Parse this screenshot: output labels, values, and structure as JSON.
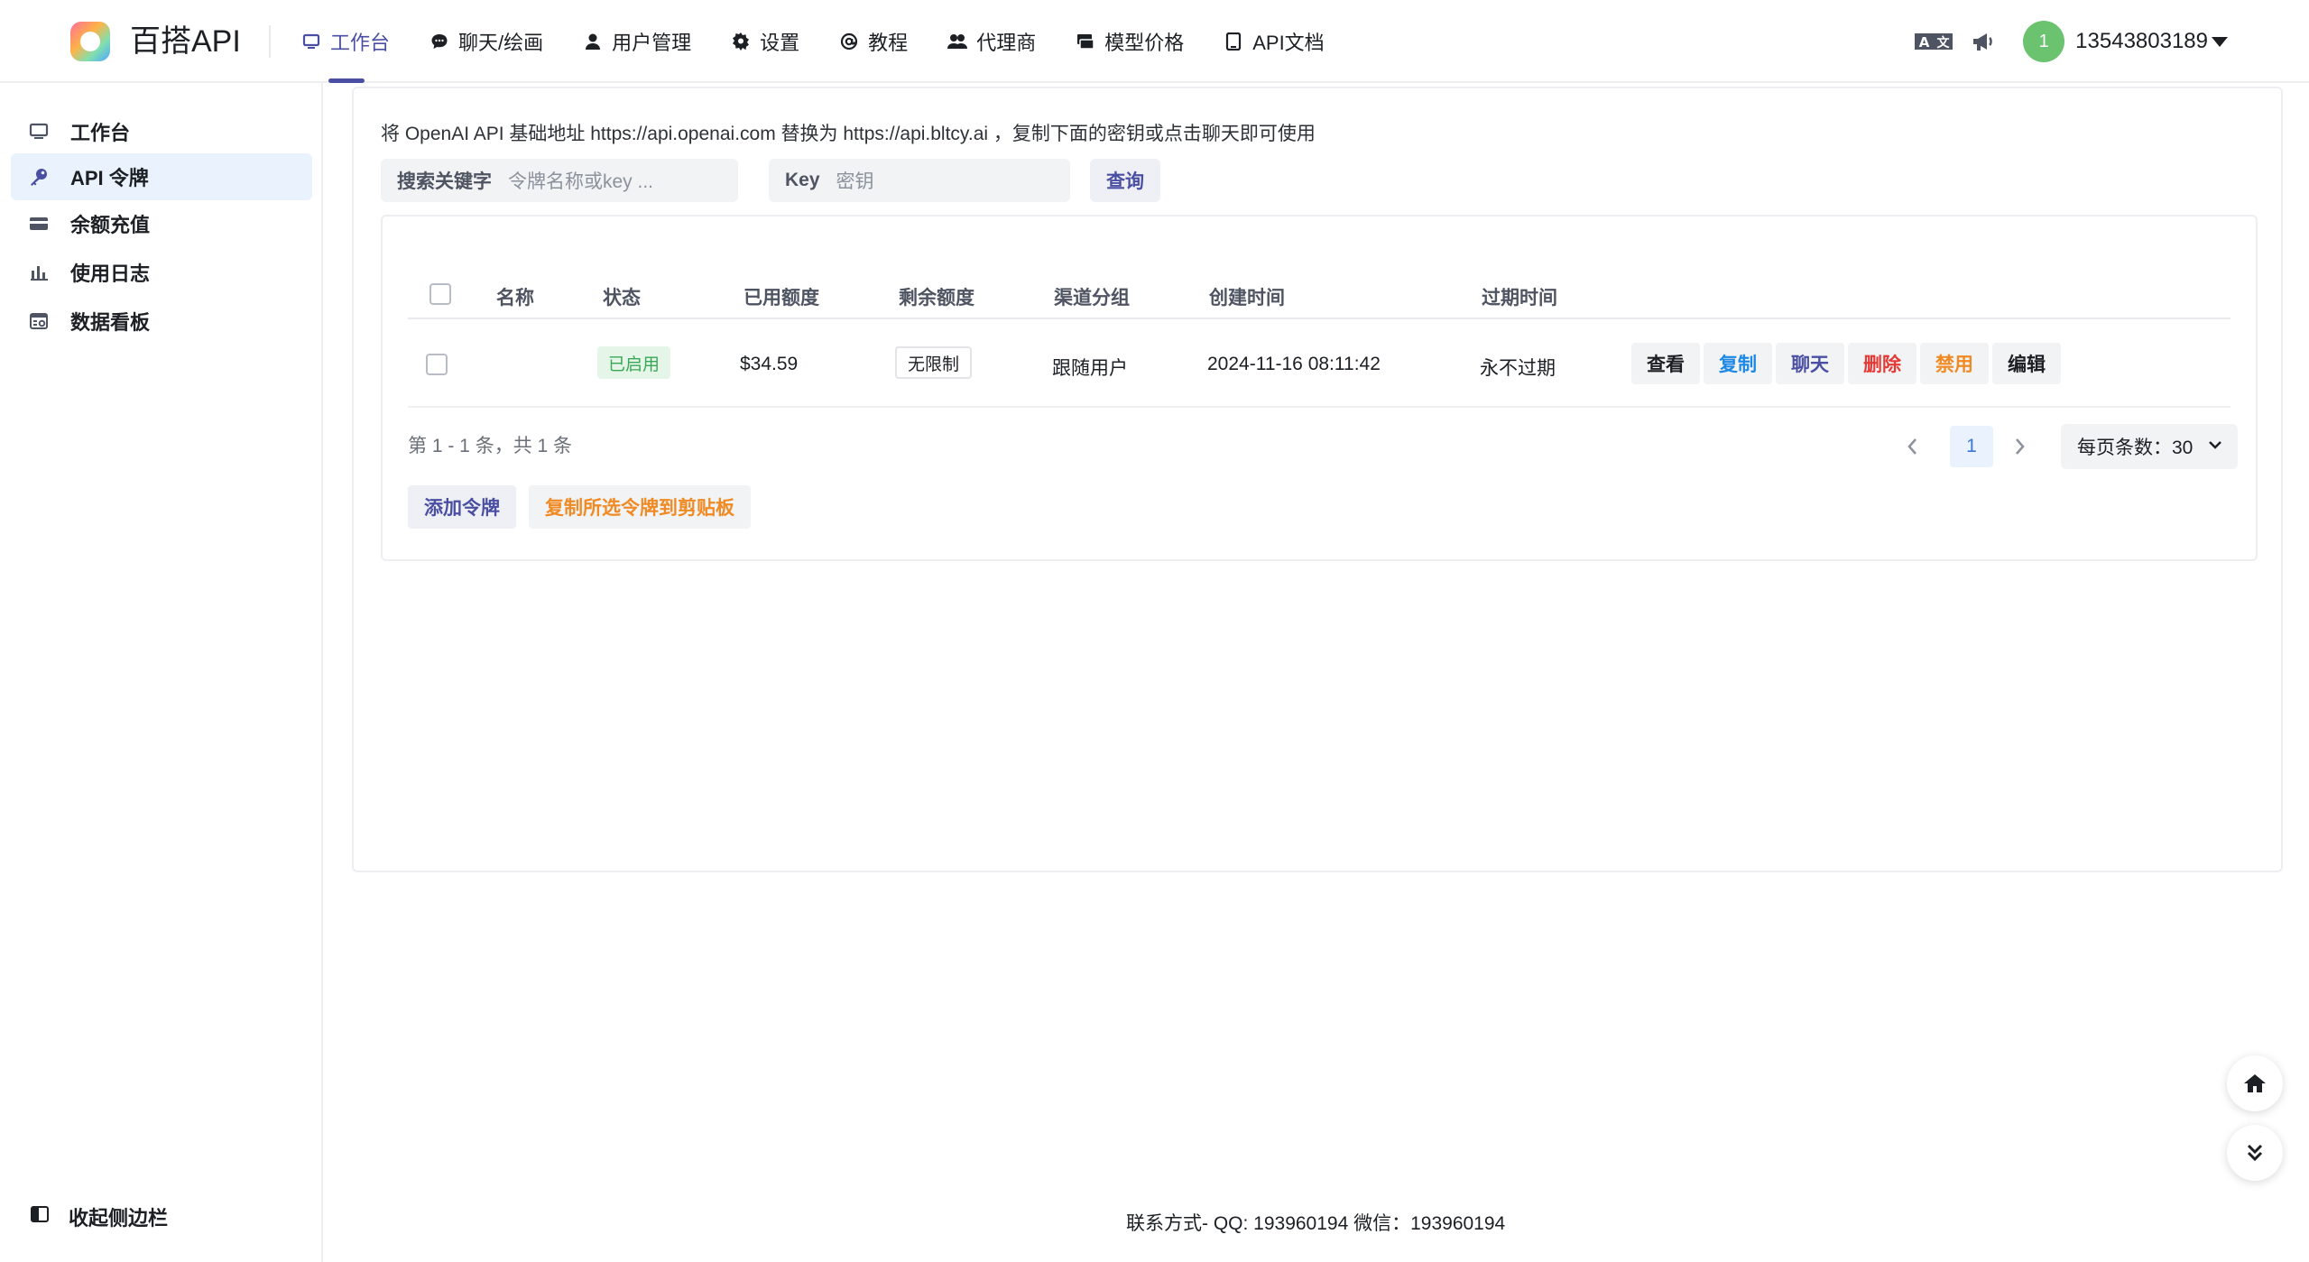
{
  "brand": {
    "name": "百搭API"
  },
  "nav": [
    {
      "label": "工作台",
      "icon": "monitor-icon",
      "active": true
    },
    {
      "label": "聊天/绘画",
      "icon": "chat-bubble-icon"
    },
    {
      "label": "用户管理",
      "icon": "user-icon"
    },
    {
      "label": "设置",
      "icon": "gear-icon"
    },
    {
      "label": "教程",
      "icon": "at-sign-icon"
    },
    {
      "label": "代理商",
      "icon": "users-icon"
    },
    {
      "label": "模型价格",
      "icon": "price-tag-icon"
    },
    {
      "label": "API文档",
      "icon": "book-icon"
    }
  ],
  "top_right": {
    "language_icon": "translate-icon",
    "announce_icon": "megaphone-icon",
    "avatar_text": "1",
    "username": "13543803189"
  },
  "sidebar": {
    "items": [
      {
        "label": "工作台",
        "icon": "monitor-icon"
      },
      {
        "label": "API 令牌",
        "icon": "key-icon",
        "active": true
      },
      {
        "label": "余额充值",
        "icon": "credit-card-icon"
      },
      {
        "label": "使用日志",
        "icon": "bar-chart-icon"
      },
      {
        "label": "数据看板",
        "icon": "dashboard-icon"
      }
    ],
    "collapse_label": "收起侧边栏"
  },
  "main": {
    "notice": "将 OpenAI API 基础地址 https://api.openai.com 替换为 https://api.bltcy.ai ，复制下面的密钥或点击聊天即可使用",
    "search_keyword_label": "搜索关键字",
    "search_keyword_placeholder": "令牌名称或key ...",
    "search_key_label": "Key",
    "search_key_placeholder": "密钥",
    "query_button": "查询"
  },
  "table": {
    "columns": [
      "名称",
      "状态",
      "已用额度",
      "剩余额度",
      "渠道分组",
      "创建时间",
      "过期时间"
    ],
    "rows": [
      {
        "name": "",
        "status": "已启用",
        "used": "$34.59",
        "remaining": "无限制",
        "group": "跟随用户",
        "created": "2024-11-16 08:11:42",
        "expires": "永不过期",
        "actions": [
          "查看",
          "复制",
          "聊天",
          "删除",
          "禁用",
          "编辑"
        ]
      }
    ]
  },
  "pagination": {
    "info": "第 1 - 1 条，共 1 条",
    "current_page": "1",
    "page_size_label": "每页条数：30"
  },
  "buttons": {
    "add_token": "添加令牌",
    "copy_selected": "复制所选令牌到剪贴板"
  },
  "footer": "联系方式- QQ: 193960194 微信：193960194",
  "colors": {
    "accent": "#4a4fa3",
    "status_green": "#3aa757",
    "copy_blue": "#1e88e5",
    "delete_red": "#e53935",
    "disable_orange": "#f08a24"
  }
}
